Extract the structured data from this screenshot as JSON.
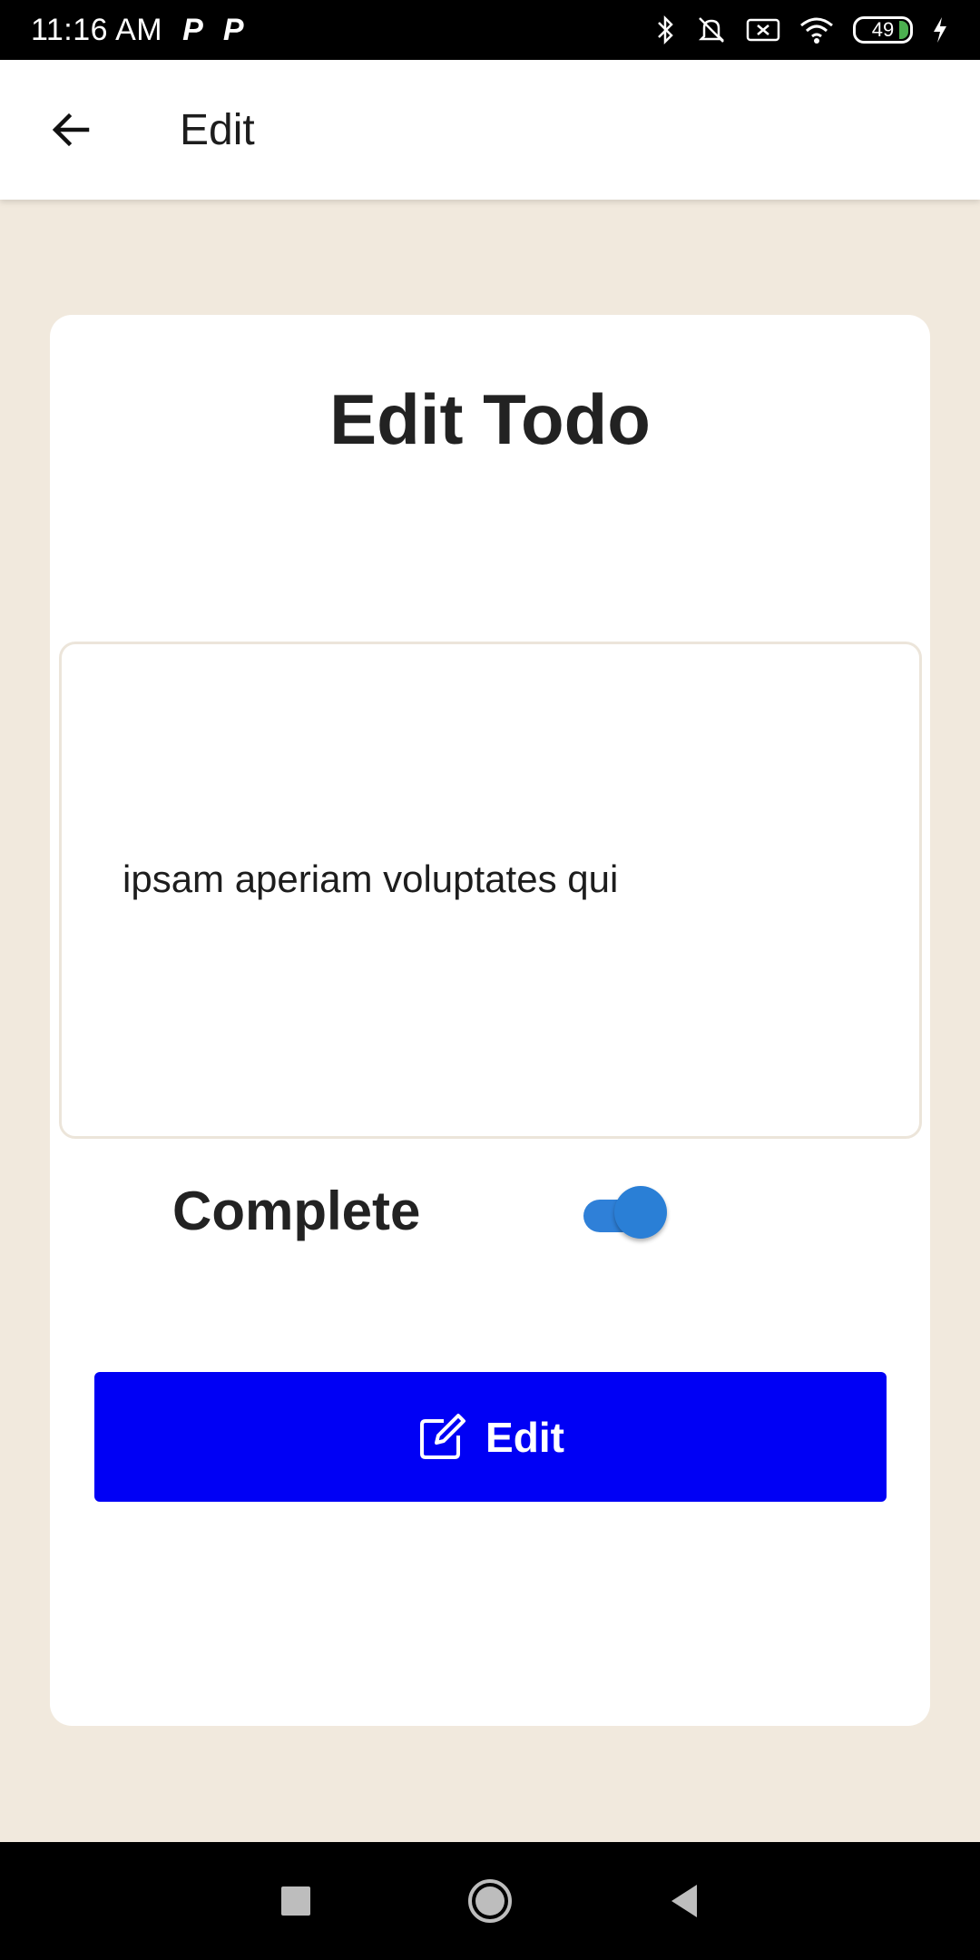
{
  "status_bar": {
    "time": "11:16 AM",
    "notification_icons": [
      "P",
      "P"
    ],
    "battery_level": "49"
  },
  "app_bar": {
    "title": "Edit",
    "back_icon": "arrow-left-icon"
  },
  "card": {
    "title": "Edit Todo",
    "todo_text": "ipsam aperiam voluptates qui",
    "complete_label": "Complete",
    "complete_toggle_on": true,
    "edit_button_label": "Edit",
    "edit_button_icon": "edit-icon"
  },
  "colors": {
    "background": "#f1e9dd",
    "button": "#0000f5",
    "toggle": "#2a7fd6"
  },
  "nav_bar": {
    "icons": [
      "square-icon",
      "circle-icon",
      "triangle-back-icon"
    ]
  }
}
